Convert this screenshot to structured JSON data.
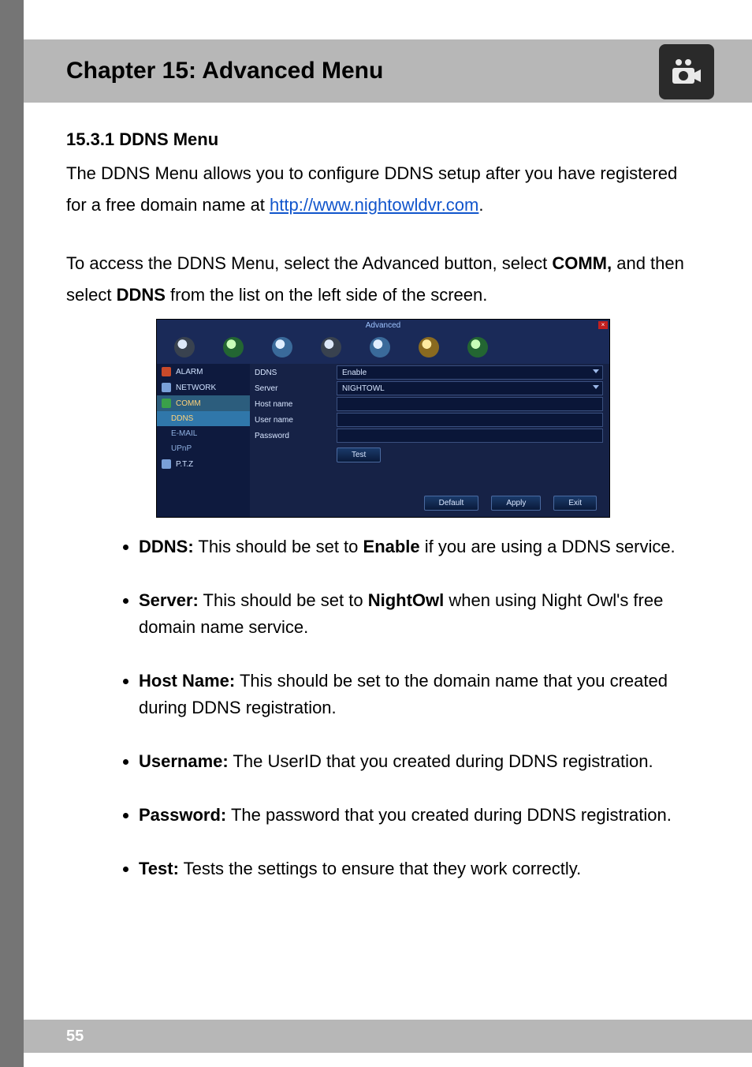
{
  "header": {
    "title": "Chapter 15: Advanced Menu"
  },
  "footer": {
    "page_number": "55"
  },
  "section": {
    "heading": "15.3.1 DDNS Menu",
    "intro_before_link": "The DDNS Menu allows you to configure DDNS setup after you have registered for a free domain name at ",
    "link_text": "http://www.nightowldvr.com",
    "intro_after_link": ".",
    "access_line_1a": "To access the DDNS Menu, select the Advanced button, select ",
    "access_line_1b": "COMM,",
    "access_line_2a": " and then select ",
    "access_line_2b": "DDNS",
    "access_line_2c": " from the list on the left side of the screen."
  },
  "screenshot": {
    "title": "Advanced",
    "close": "×",
    "sidebar": [
      {
        "icon": "alarm",
        "label": "ALARM",
        "class": ""
      },
      {
        "icon": "network",
        "label": "NETWORK",
        "class": ""
      },
      {
        "icon": "comm",
        "label": "COMM",
        "class": "sel"
      },
      {
        "icon": "ddns",
        "label": "DDNS",
        "class": "sub sel"
      },
      {
        "icon": "email",
        "label": "E-MAIL",
        "class": "sub"
      },
      {
        "icon": "upnp",
        "label": "UPnP",
        "class": "sub"
      },
      {
        "icon": "ptz",
        "label": "P.T.Z",
        "class": ""
      }
    ],
    "form": {
      "rows": [
        {
          "label": "DDNS",
          "value": "Enable",
          "dropdown": true
        },
        {
          "label": "Server",
          "value": "NIGHTOWL",
          "dropdown": true
        },
        {
          "label": "Host name",
          "value": "",
          "dropdown": false
        },
        {
          "label": "User name",
          "value": "",
          "dropdown": false
        },
        {
          "label": "Password",
          "value": "",
          "dropdown": false
        }
      ],
      "test_button": "Test"
    },
    "buttons": {
      "default": "Default",
      "apply": "Apply",
      "exit": "Exit"
    }
  },
  "bullets": [
    {
      "term": "DDNS:",
      "text_before": " This should be set to ",
      "term2": "Enable",
      "text_after": " if you are using a DDNS service."
    },
    {
      "term": "Server:",
      "text_before": " This should be set to ",
      "term2": "NightOwl",
      "text_after": " when using Night Owl's free domain name service."
    },
    {
      "term": "Host Name:",
      "text_before": " This should be set to the domain name that you created during DDNS registration.",
      "term2": "",
      "text_after": ""
    },
    {
      "term": "Username:",
      "text_before": " The UserID that you created during DDNS registration.",
      "term2": "",
      "text_after": ""
    },
    {
      "term": "Password:",
      "text_before": " The password that you created during DDNS registration.",
      "term2": "",
      "text_after": ""
    },
    {
      "term": "Test:",
      "text_before": " Tests the settings to ensure that they work correctly.",
      "term2": "",
      "text_after": ""
    }
  ]
}
